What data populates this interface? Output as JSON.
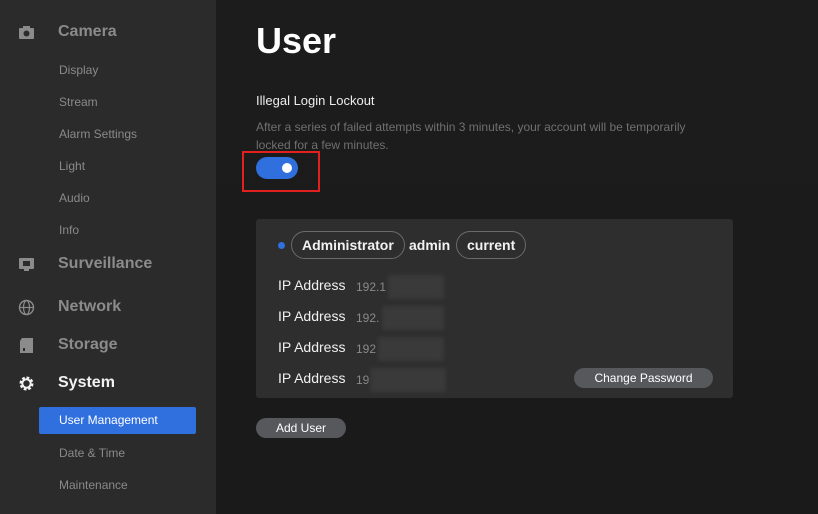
{
  "sidebar": {
    "sections": [
      {
        "label": "Camera",
        "icon": "camera-icon"
      },
      {
        "label": "Surveillance",
        "icon": "monitor-icon"
      },
      {
        "label": "Network",
        "icon": "globe-icon"
      },
      {
        "label": "Storage",
        "icon": "storage-icon"
      },
      {
        "label": "System",
        "icon": "gear-icon",
        "active": true
      }
    ],
    "camera_items": [
      "Display",
      "Stream",
      "Alarm Settings",
      "Light",
      "Audio",
      "Info"
    ],
    "system_items": [
      "User Management",
      "Date & Time",
      "Maintenance"
    ],
    "active_item": "User Management"
  },
  "main": {
    "title": "User",
    "lockout": {
      "title": "Illegal Login Lockout",
      "description": "After a series of failed attempts within 3 minutes, your account will be temporarily locked for a few minutes.",
      "enabled": true
    },
    "user_card": {
      "role": "Administrator",
      "username": "admin",
      "status": "current",
      "ip_rows": [
        {
          "label": "IP Address",
          "value": "192.1"
        },
        {
          "label": "IP Address",
          "value": "192."
        },
        {
          "label": "IP Address",
          "value": "192"
        },
        {
          "label": "IP Address",
          "value": "19"
        }
      ],
      "change_password_label": "Change Password"
    },
    "add_user_label": "Add User"
  },
  "colors": {
    "accent": "#2f6fde",
    "highlight": "#e32020",
    "sidebar_bg": "#2b2b2b",
    "card_bg": "#2e2e2e"
  }
}
